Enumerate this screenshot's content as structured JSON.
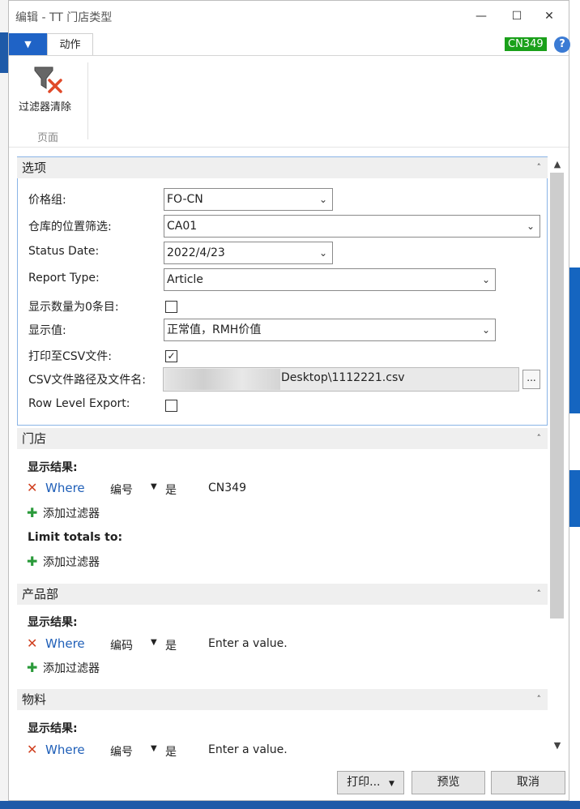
{
  "window": {
    "title": "编辑 - TT 门店类型",
    "minimize_glyph": "—",
    "maximize_glyph": "☐",
    "close_glyph": "✕"
  },
  "ribbon": {
    "menu_glyph": "▼",
    "tab_label": "动作",
    "company_badge": "CN349",
    "help_glyph": "?",
    "clear_filter_label": "过滤器清除",
    "group_label": "页面"
  },
  "options": {
    "header": "选项",
    "price_group_label": "价格组:",
    "price_group_value": "FO-CN",
    "location_filter_label": "仓库的位置筛选:",
    "location_filter_value": "CA01",
    "status_date_label": "Status Date:",
    "status_date_value": "2022/4/23",
    "report_type_label": "Report Type:",
    "report_type_value": "Article",
    "show_zero_label": "显示数量为0条目:",
    "show_zero_checked": false,
    "show_value_label": "显示值:",
    "show_value_value": "正常值，RMH价值",
    "print_csv_label": "打印至CSV文件:",
    "print_csv_checked": true,
    "csv_path_label": "CSV文件路径及文件名:",
    "csv_path_value": "Desktop\\1112221.csv",
    "csv_browse_label": "...",
    "row_level_label": "Row Level Export:",
    "row_level_checked": false
  },
  "store": {
    "header": "门店",
    "show_results_label": "显示结果:",
    "filter": {
      "where": "Where",
      "field": "编号",
      "op": "是",
      "value": "CN349"
    },
    "add_filter_label": "添加过滤器",
    "limit_totals_label": "Limit totals to:",
    "add_filter2_label": "添加过滤器"
  },
  "product_dept": {
    "header": "产品部",
    "show_results_label": "显示结果:",
    "filter": {
      "where": "Where",
      "field": "编码",
      "op": "是",
      "value": "Enter a value."
    },
    "add_filter_label": "添加过滤器"
  },
  "material": {
    "header": "物料",
    "show_results_label": "显示结果:",
    "filter": {
      "where": "Where",
      "field": "编号",
      "op": "是",
      "value": "Enter a value."
    }
  },
  "footer": {
    "print_label": "打印...",
    "preview_label": "预览",
    "cancel_label": "取消"
  },
  "icons": {
    "check": "✓",
    "remove": "✕",
    "add": "✚",
    "dropdown": "⌄",
    "collapse": "˄"
  },
  "colors": {
    "accent": "#1f63c6",
    "badge": "#1aa01a",
    "where_link": "#1f5fb8",
    "remove": "#d04020",
    "add": "#2a9a3a"
  }
}
